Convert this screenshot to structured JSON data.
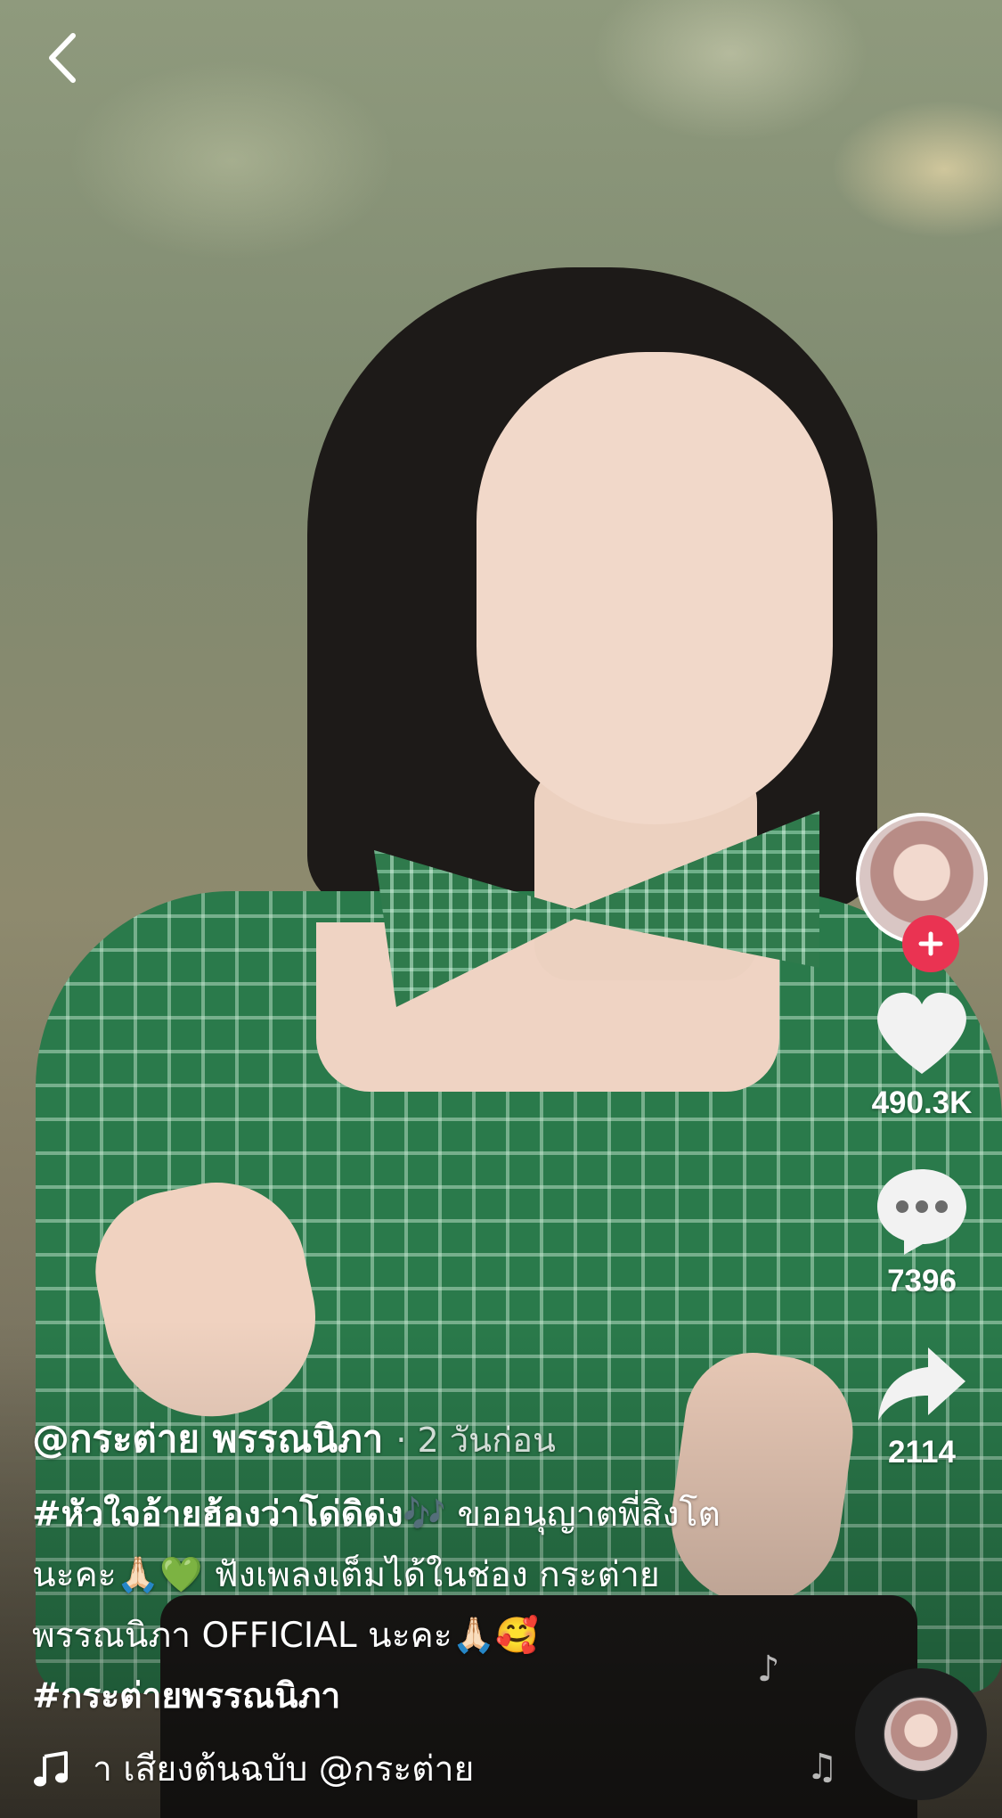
{
  "creator": {
    "name": "@กระต่าย  พรรณนิภา",
    "posted": "· 2 วันก่อน"
  },
  "caption": {
    "hashtag_song": "#หัวใจอ้ายฮ้องว่าโด่ดิด่ง🎶",
    "text_1": " ขออนุญาตพี่สิงโตนะคะ🙏🏻💚 ฟังเพลงเต็มได้ในช่อง กระต่าย พรรณนิภา OFFICIAL นะคะ🙏🏻🥰",
    "hashtag_artist": "#กระต่ายพรรณนิภา"
  },
  "actions": {
    "likes": "490.3K",
    "comments": "7396",
    "shares": "2114"
  },
  "music": {
    "label": "า เสียงต้นฉบับ    @กระต่าย"
  },
  "icons": {
    "back": "chevron-left-icon",
    "follow": "plus-icon",
    "like": "heart-icon",
    "comment": "comment-icon",
    "share": "share-icon",
    "music": "music-note-icon"
  },
  "colors": {
    "follow_button": "#ea3352",
    "text": "#ffffff"
  }
}
